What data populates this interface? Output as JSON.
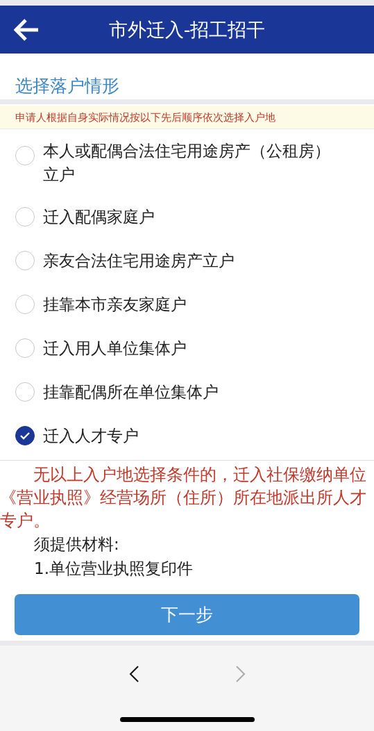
{
  "header": {
    "title": "市外迁入-招工招干"
  },
  "section_title": "选择落户情形",
  "notice": "申请人根据自身实际情况按以下先后顺序依次选择入户地",
  "options": [
    {
      "label": "本人或配偶合法住宅用途房产（公租房）立户",
      "selected": false
    },
    {
      "label": "迁入配偶家庭户",
      "selected": false
    },
    {
      "label": "亲友合法住宅用途房产立户",
      "selected": false
    },
    {
      "label": "挂靠本市亲友家庭户",
      "selected": false
    },
    {
      "label": "迁入用人单位集体户",
      "selected": false
    },
    {
      "label": "挂靠配偶所在单位集体户",
      "selected": false
    },
    {
      "label": "迁入人才专户",
      "selected": true
    }
  ],
  "description": "无以上入户地选择条件的，迁入社保缴纳单位《营业执照》经营场所（住所）所在地派出所人才专户。",
  "materials": [
    "须提供材料:",
    "1.单位营业执照复印件"
  ],
  "next_button": "下一步",
  "browser_nav": {
    "back": {
      "disabled": false
    },
    "forward": {
      "disabled": true
    }
  }
}
